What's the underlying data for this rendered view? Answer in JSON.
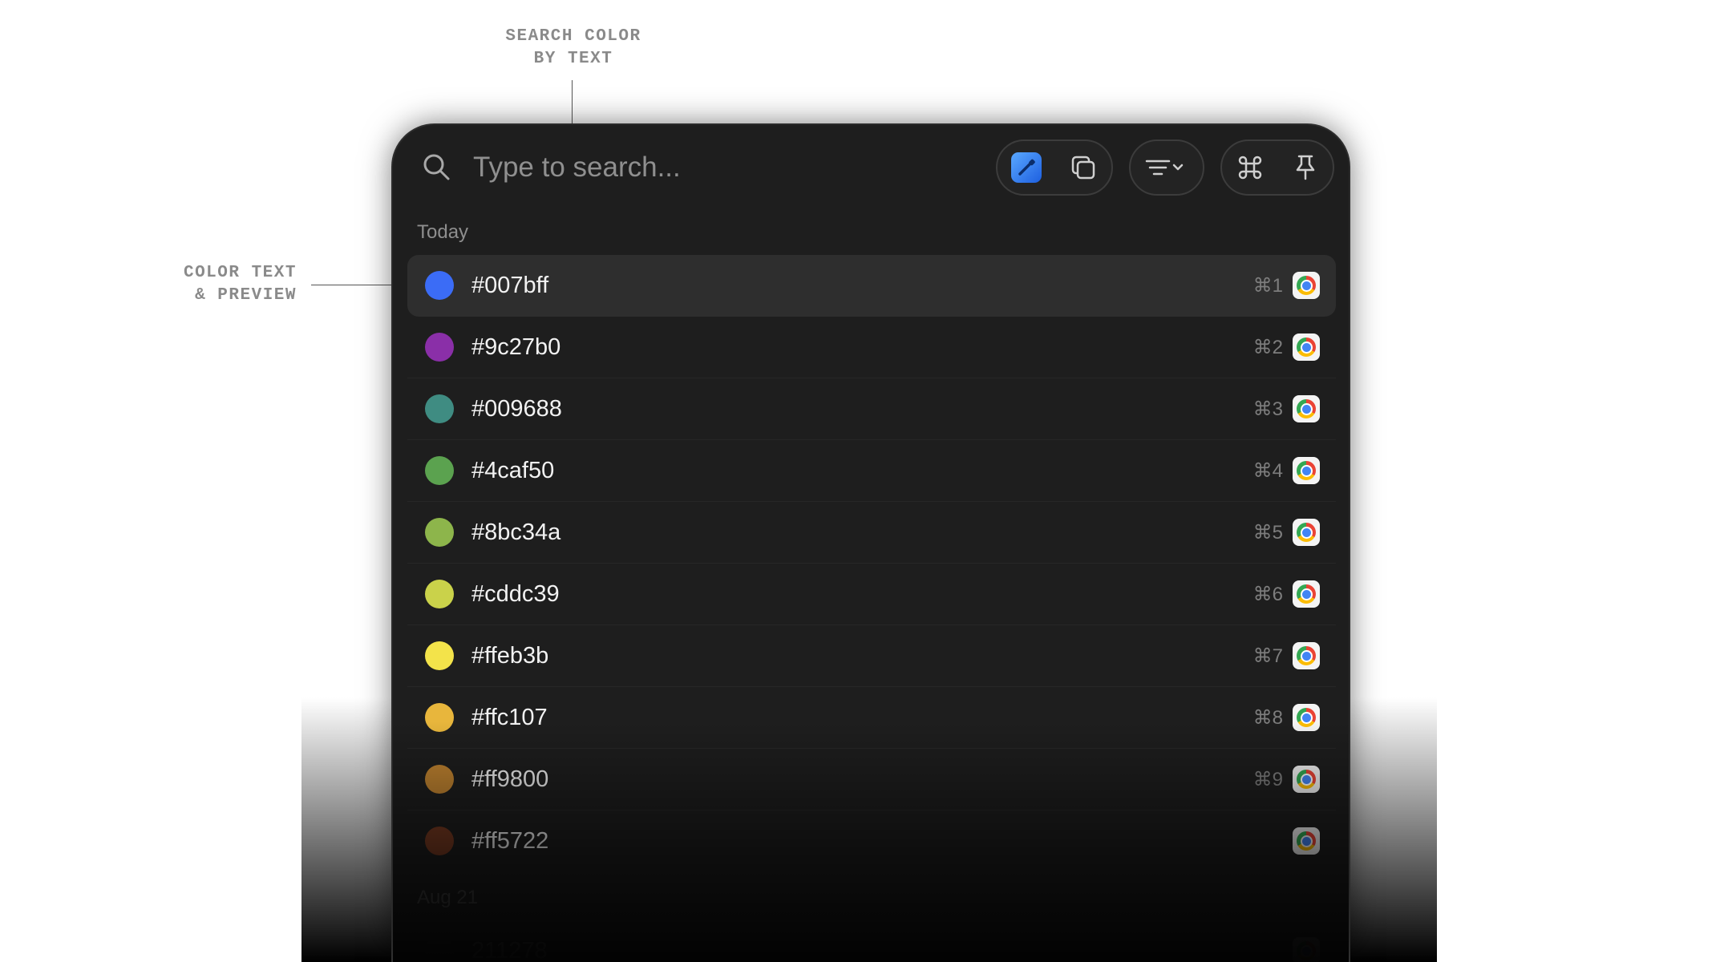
{
  "annotations": {
    "search": "SEARCH COLOR\nBY TEXT",
    "preview": "COLOR TEXT\n& PREVIEW"
  },
  "search": {
    "placeholder": "Type to search...",
    "icon": "magnifier-icon"
  },
  "toolbar": {
    "icons": [
      "color-picker-icon",
      "copy-icon",
      "filter-icon",
      "command-icon",
      "pin-icon"
    ]
  },
  "sections": [
    {
      "label": "Today",
      "items": [
        {
          "hex": "#007bff",
          "swatch": "#3b6cf6",
          "shortcut": "⌘1",
          "app_icon": "chrome-icon",
          "selected": true
        },
        {
          "hex": "#9c27b0",
          "swatch": "#8a2fa8",
          "shortcut": "⌘2",
          "app_icon": "chrome-icon"
        },
        {
          "hex": "#009688",
          "swatch": "#3f8c82",
          "shortcut": "⌘3",
          "app_icon": "chrome-icon"
        },
        {
          "hex": "#4caf50",
          "swatch": "#5ba24f",
          "shortcut": "⌘4",
          "app_icon": "chrome-icon"
        },
        {
          "hex": "#8bc34a",
          "swatch": "#8db54b",
          "shortcut": "⌘5",
          "app_icon": "chrome-icon"
        },
        {
          "hex": "#cddc39",
          "swatch": "#cad24a",
          "shortcut": "⌘6",
          "app_icon": "chrome-icon"
        },
        {
          "hex": "#ffeb3b",
          "swatch": "#f3e34a",
          "shortcut": "⌘7",
          "app_icon": "chrome-icon"
        },
        {
          "hex": "#ffc107",
          "swatch": "#e8b63c",
          "shortcut": "⌘8",
          "app_icon": "chrome-icon"
        },
        {
          "hex": "#ff9800",
          "swatch": "#c08330",
          "shortcut": "⌘9",
          "app_icon": "chrome-icon"
        },
        {
          "hex": "#ff5722",
          "swatch": "#7a3b22",
          "shortcut": "",
          "app_icon": "chrome-icon"
        }
      ]
    },
    {
      "label": "Aug 21",
      "items": [
        {
          "hex": "211278",
          "app_icon": "chrome-icon"
        }
      ]
    }
  ],
  "colors": {
    "window_bg": "#1e1e1e",
    "selected_row": "#2e2e2e",
    "picker_accent": "#2f7bf5"
  }
}
